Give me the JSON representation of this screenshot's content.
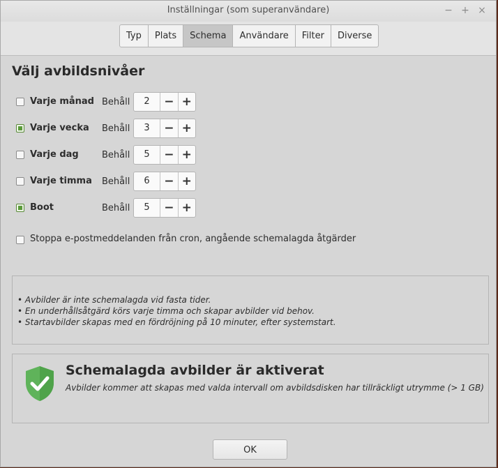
{
  "window": {
    "title": "Inställningar (som superanvändare)",
    "controls": [
      "−",
      "+",
      "×"
    ]
  },
  "tabs": [
    {
      "label": "Typ"
    },
    {
      "label": "Plats"
    },
    {
      "label": "Schema",
      "active": true
    },
    {
      "label": "Användare"
    },
    {
      "label": "Filter"
    },
    {
      "label": "Diverse"
    }
  ],
  "schedule": {
    "heading": "Välj avbildsnivåer",
    "keep_label": "Behåll",
    "levels": [
      {
        "label": "Varje månad",
        "checked": false,
        "keep": "2"
      },
      {
        "label": "Varje vecka",
        "checked": true,
        "keep": "3"
      },
      {
        "label": "Varje dag",
        "checked": false,
        "keep": "5"
      },
      {
        "label": "Varje timma",
        "checked": false,
        "keep": "6"
      },
      {
        "label": "Boot",
        "checked": true,
        "keep": "5"
      }
    ],
    "stepper_minus": "−",
    "stepper_plus": "+",
    "cron_label": "Stoppa e-postmeddelanden från cron, angående schemalagda åtgärder",
    "cron_checked": false
  },
  "info": {
    "lines": [
      "• Avbilder är inte schemalagda vid fasta tider.",
      "• En underhållsåtgärd körs varje timma och skapar avbilder vid behov.",
      "• Startavbilder skapas med en fördröjning på 10 minuter, efter systemstart."
    ]
  },
  "status": {
    "title": "Schemalagda avbilder är aktiverat",
    "description": "Avbilder kommer att skapas med valda intervall om avbildsdisken har tillräckligt utrymme (> 1 GB)",
    "icon": "shield-check-icon",
    "icon_color": "#5fb35a"
  },
  "ok_label": "OK"
}
